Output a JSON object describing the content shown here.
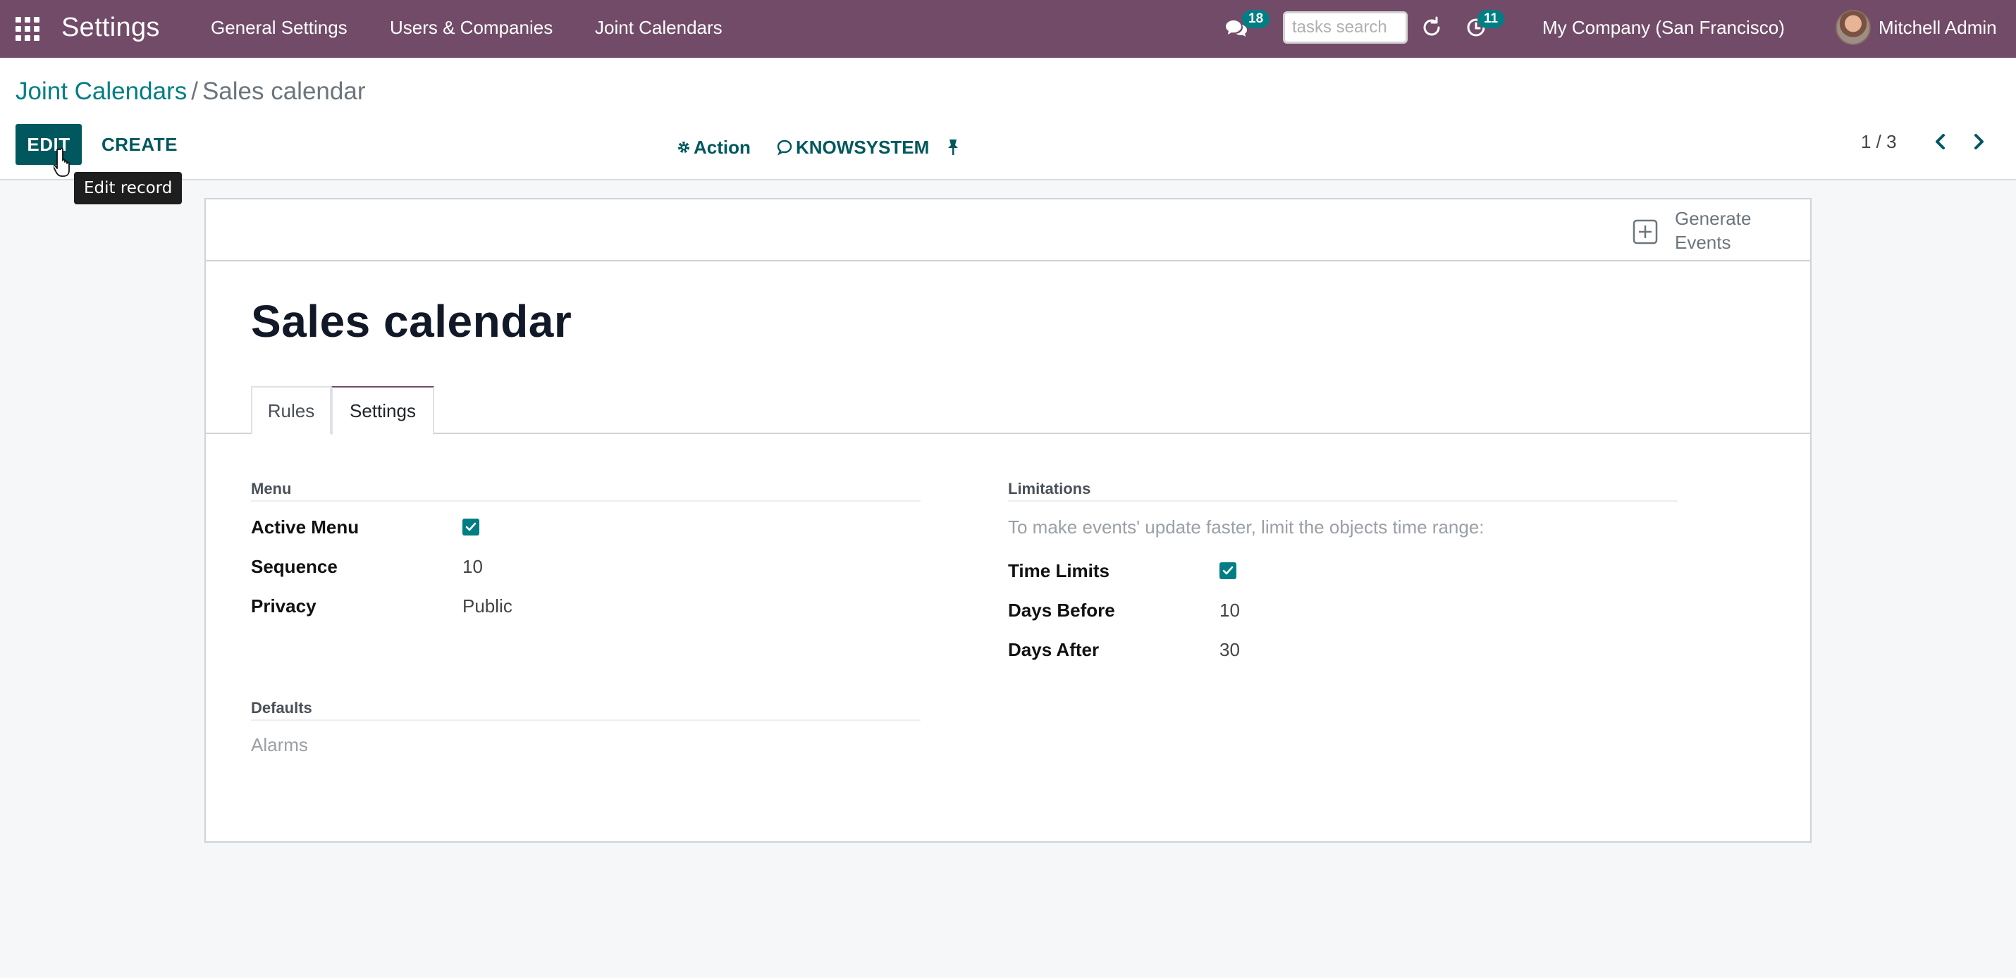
{
  "navbar": {
    "app_title": "Settings",
    "menu": [
      "General Settings",
      "Users & Companies",
      "Joint Calendars"
    ],
    "chat_badge": "18",
    "search_placeholder": "tasks search",
    "activity_badge": "11",
    "company": "My Company (San Francisco)",
    "user": "Mitchell Admin"
  },
  "breadcrumb": {
    "parent": "Joint Calendars",
    "separator": "/",
    "current": "Sales calendar"
  },
  "buttons": {
    "edit": "EDIT",
    "create": "CREATE",
    "edit_tooltip": "Edit record"
  },
  "actions": {
    "action": "Action",
    "knowsystem": "KNOWSYSTEM"
  },
  "pager": {
    "value": "1 / 3"
  },
  "sheet": {
    "generate_button": "Generate Events",
    "title": "Sales calendar",
    "tabs": [
      "Rules",
      "Settings"
    ],
    "active_tab": "Settings"
  },
  "menu_group": {
    "title": "Menu",
    "active_menu_label": "Active Menu",
    "active_menu_checked": true,
    "sequence_label": "Sequence",
    "sequence_value": "10",
    "privacy_label": "Privacy",
    "privacy_value": "Public"
  },
  "defaults_group": {
    "title": "Defaults",
    "alarms_label": "Alarms"
  },
  "limitations_group": {
    "title": "Limitations",
    "hint": "To make events' update faster, limit the objects time range:",
    "time_limits_label": "Time Limits",
    "time_limits_checked": true,
    "days_before_label": "Days Before",
    "days_before_value": "10",
    "days_after_label": "Days After",
    "days_after_value": "30"
  },
  "colors": {
    "navbar": "#714b67",
    "primary": "#017e84",
    "primary_dark": "#00585e"
  }
}
